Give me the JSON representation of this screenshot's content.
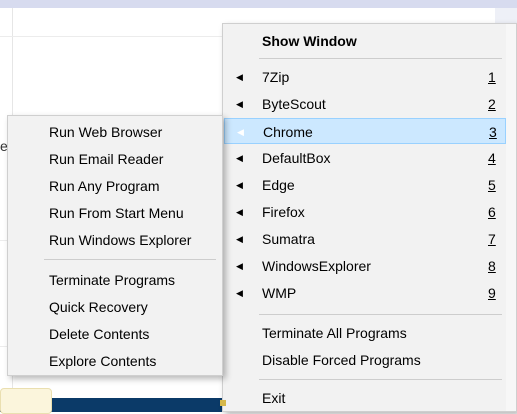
{
  "background": {
    "partial_text": "e"
  },
  "main_menu": {
    "header": "Show Window",
    "items": [
      {
        "label": "7Zip",
        "key": "1",
        "has_submenu": true
      },
      {
        "label": "ByteScout",
        "key": "2",
        "has_submenu": true
      },
      {
        "label": "Chrome",
        "key": "3",
        "has_submenu": true,
        "highlighted": true
      },
      {
        "label": "DefaultBox",
        "key": "4",
        "has_submenu": true
      },
      {
        "label": "Edge",
        "key": "5",
        "has_submenu": true
      },
      {
        "label": "Firefox",
        "key": "6",
        "has_submenu": true
      },
      {
        "label": "Sumatra",
        "key": "7",
        "has_submenu": true
      },
      {
        "label": "WindowsExplorer",
        "key": "8",
        "has_submenu": true
      },
      {
        "label": "WMP",
        "key": "9",
        "has_submenu": true
      }
    ],
    "actions": [
      "Terminate All Programs",
      "Disable Forced Programs"
    ],
    "exit": "Exit"
  },
  "submenu": {
    "run_items": [
      "Run Web Browser",
      "Run Email Reader",
      "Run Any Program",
      "Run From Start Menu",
      "Run Windows Explorer"
    ],
    "other_items": [
      "Terminate Programs",
      "Quick Recovery",
      "Delete Contents",
      "Explore Contents"
    ]
  },
  "colors": {
    "highlight_bg": "#cce8ff",
    "highlight_border": "#99d1ff",
    "menu_bg": "#f2f2f2",
    "taskbar": "#0b3a68"
  }
}
